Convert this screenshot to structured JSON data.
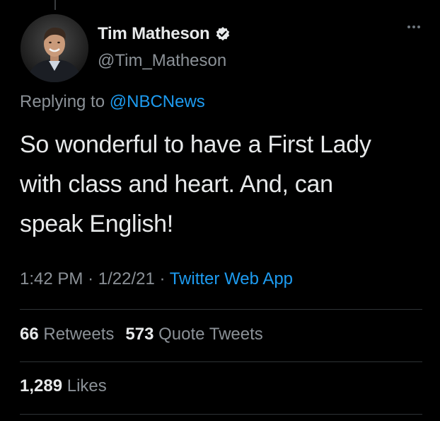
{
  "tweet": {
    "author": {
      "display_name": "Tim Matheson",
      "handle": "@Tim_Matheson",
      "verified": true,
      "avatar_icon": "profile-photo"
    },
    "replying_to_prefix": "Replying to",
    "replying_to_handle": "@NBCNews",
    "text": "So wonderful to have a First Lady\nwith class and heart.  And, can\nspeak English!",
    "time": "1:42 PM",
    "date": "1/22/21",
    "separator": "·",
    "source": "Twitter Web App",
    "stats": {
      "retweets_count": "66",
      "retweets_label": "Retweets",
      "quote_tweets_count": "573",
      "quote_tweets_label": "Quote Tweets",
      "likes_count": "1,289",
      "likes_label": "Likes"
    }
  },
  "icons": {
    "verified": "verified-badge-icon",
    "more": "more-options-icon"
  },
  "colors": {
    "background": "#000000",
    "text_primary": "#e7e9ea",
    "text_secondary": "#8b9197",
    "accent": "#1d9bf0",
    "divider": "#2f3336"
  }
}
